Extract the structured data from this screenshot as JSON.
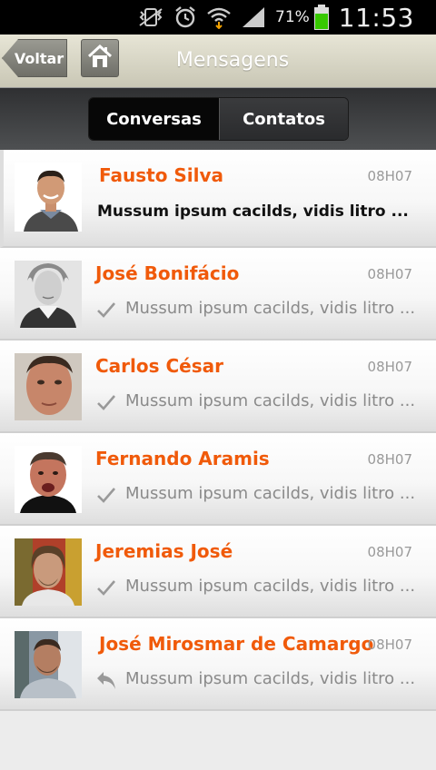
{
  "status_bar": {
    "battery_pct": "71%",
    "time": "11:53"
  },
  "header": {
    "back_label": "Voltar",
    "title": "Mensagens"
  },
  "tabs": {
    "active": "Conversas",
    "inactive": "Contatos"
  },
  "conversations": [
    {
      "name": "Fausto Silva",
      "time": "08H07",
      "preview": "Mussum ipsum cacilds, vidis litro ...",
      "status": "unread"
    },
    {
      "name": "José Bonifácio",
      "time": "08H07",
      "preview": "Mussum ipsum cacilds, vidis litro ...",
      "status": "read"
    },
    {
      "name": "Carlos César",
      "time": "08H07",
      "preview": "Mussum ipsum cacilds, vidis litro ...",
      "status": "read"
    },
    {
      "name": "Fernando Aramis",
      "time": "08H07",
      "preview": "Mussum ipsum cacilds, vidis litro ...",
      "status": "read"
    },
    {
      "name": "Jeremias José",
      "time": "08H07",
      "preview": "Mussum ipsum cacilds, vidis litro ...",
      "status": "read"
    },
    {
      "name": "José Mirosmar de Camargo",
      "time": "08H07",
      "preview": "Mussum ipsum cacilds, vidis litro ...",
      "status": "replied"
    }
  ],
  "colors": {
    "accent": "#f05a0a",
    "status_bar_bg": "#000000",
    "tab_bar_bg": "#3a3b3d"
  }
}
